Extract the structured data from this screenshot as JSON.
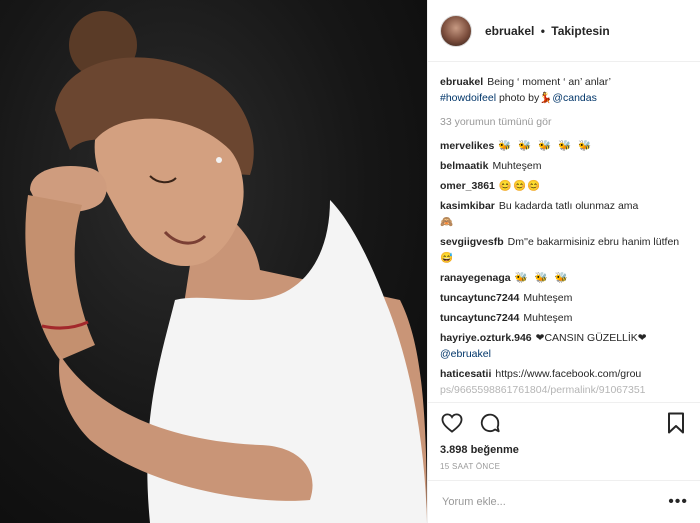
{
  "header": {
    "username": "ebruakel",
    "separator": "•",
    "follow_label": "Takiptesin"
  },
  "caption": {
    "username": "ebruakel",
    "text": "Being ‘ moment ‘ an’ anlar’",
    "hashtag": "#howdoifeel",
    "photo_by": "photo by",
    "mention": "@candas",
    "emoji_icon": "woman-dancing-emoji"
  },
  "view_all_comments": "33 yorumun tümünü gör",
  "comments": [
    {
      "user": "mervelikes",
      "text": "",
      "emoji": "🐝 🐝 🐝 🐝 🐝"
    },
    {
      "user": "belmaatik",
      "text": "Muhteşem",
      "emoji": ""
    },
    {
      "user": "omer_3861",
      "text": "",
      "emoji": "😊😊😊"
    },
    {
      "user": "kasimkibar",
      "text": "Bu kadarda tatlı olunmaz ama",
      "emoji": "🙈"
    },
    {
      "user": "sevgiigvesfb",
      "text": "Dm''e bakarmisiniz ebru hanim lütfen",
      "emoji": "😅"
    },
    {
      "user": "ranayegenaga",
      "text": "",
      "emoji": "🐝 🐝 🐝"
    },
    {
      "user": "tuncaytunc7244",
      "text": "Muhteşem",
      "emoji": ""
    },
    {
      "user": "tuncaytunc7244",
      "text": "Muhteşem",
      "emoji": ""
    },
    {
      "user": "hayriye.ozturk.946",
      "text": "❤CANSIN GÜZELLİK❤",
      "mention": "@ebruakel"
    },
    {
      "user": "haticesatii",
      "text": "https://www.facebook.com/grou",
      "text2": "ps/9665598861761804/permalink/91067351"
    }
  ],
  "actions": {
    "like_icon": "heart-icon",
    "comment_icon": "comment-icon",
    "save_icon": "bookmark-icon"
  },
  "likes_text": "3.898 beğenme",
  "timestamp": "15 SAAT ÖNCE",
  "add_comment": {
    "placeholder": "Yorum ekle...",
    "more_label": "•••"
  },
  "colors": {
    "text": "#262626",
    "muted": "#999999",
    "link": "#003569",
    "border": "#efefef"
  }
}
